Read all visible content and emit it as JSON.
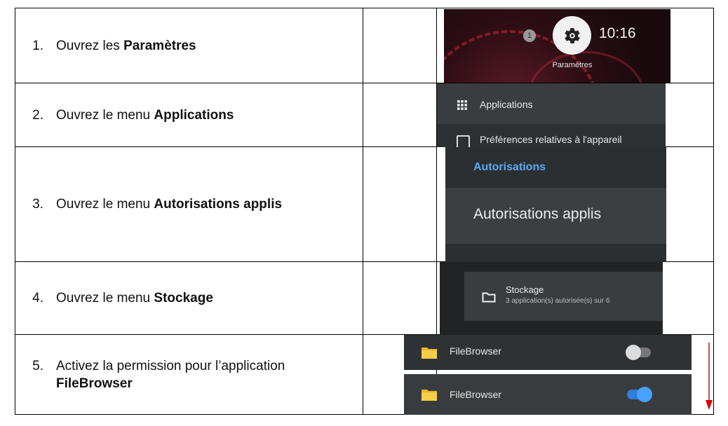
{
  "steps": [
    {
      "num": "1.",
      "text": "Ouvrez les ",
      "bold": "Paramètres"
    },
    {
      "num": "2.",
      "text": "Ouvrez le menu ",
      "bold": "Applications"
    },
    {
      "num": "3.",
      "text": "Ouvrez le menu ",
      "bold": "Autorisations applis"
    },
    {
      "num": "4.",
      "text": "Ouvrez le menu ",
      "bold": "Stockage"
    },
    {
      "num": "5.",
      "text": "Activez la permission pour l’application ",
      "bold": "FileBrowser"
    }
  ],
  "shot1": {
    "badge": "1",
    "time": "10:16",
    "label": "Paramètres",
    "icon": "gear-icon"
  },
  "shot2": {
    "item1": "Applications",
    "item1_icon": "grid-icon",
    "item2": "Préférences relatives à l'appareil",
    "item2_icon": "square-icon"
  },
  "shot3": {
    "header": "Autorisations",
    "item": "Autorisations applis"
  },
  "shot4": {
    "title": "Stockage",
    "subtitle": "3 application(s) autorisée(s) sur 6",
    "icon": "folder-icon"
  },
  "shot5": {
    "app_off": "FileBrowser",
    "app_on": "FileBrowser",
    "toggle_off": false,
    "toggle_on": true
  },
  "colors": {
    "accent": "#4aa0ff",
    "header_blue": "#5aa9f0",
    "arrow": "#e00000"
  }
}
